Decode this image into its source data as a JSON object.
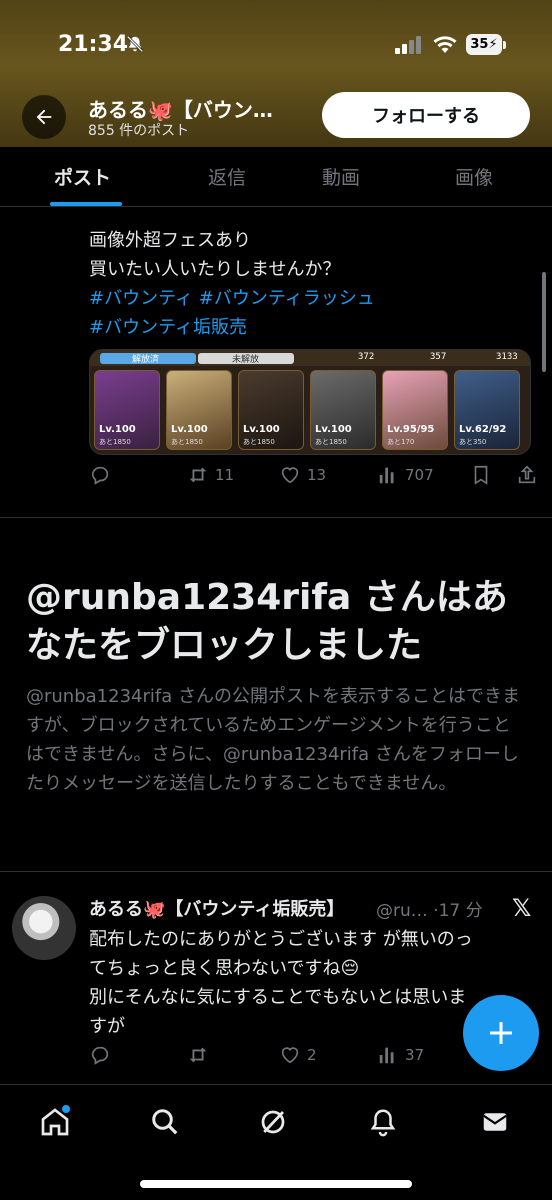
{
  "status_bar": {
    "time": "21:34",
    "battery": "35"
  },
  "header": {
    "name": "あるる🐙【バウン…",
    "post_count": "855 件のポスト",
    "follow_label": "フォローする"
  },
  "tabs": [
    {
      "label": "ポスト"
    },
    {
      "label": "返信"
    },
    {
      "label": "動画"
    },
    {
      "label": "画像"
    }
  ],
  "post1": {
    "line1": "画像外超フェスあり",
    "line2": "買いたい人いたりしませんか？",
    "hashtag1": "#バウンティ",
    "hashtag2": "#バウンティラッシュ",
    "hashtag3": "#バウンティ垢販売",
    "media": {
      "tab1": "解放済",
      "tab2": "未解放",
      "num1": "372",
      "num2": "357",
      "num3": "3133",
      "cards": [
        {
          "lv": "Lv.100",
          "sub": "あと1850"
        },
        {
          "lv": "Lv.100",
          "sub": "あと1850"
        },
        {
          "lv": "Lv.100",
          "sub": "あと1850"
        },
        {
          "lv": "Lv.100",
          "sub": "あと1850"
        },
        {
          "lv": "Lv.95/95",
          "sub": "あと170"
        },
        {
          "lv": "Lv.62/92",
          "sub": "あと350"
        }
      ]
    },
    "stats": {
      "retweets": "11",
      "likes": "13",
      "views": "707"
    }
  },
  "blocked": {
    "title": "@runba1234rifa さんはあなたをブロックしました",
    "body": "@runba1234rifa さんの公開ポストを表示することはできますが、ブロックされているためエンゲージメントを行うことはできません。さらに、@runba1234rifa さんをフォローしたりメッセージを送信したりすることもできません。"
  },
  "post2": {
    "name": "あるる🐙【バウンティ垢販売】",
    "handle_time": "@ru… ·17 分",
    "text_line1": "配布したのにありがとうございます が無いのっ",
    "text_line2": "てちょっと良く思わないですね😔",
    "text_line3": "別にそんなに気にすることでもないとは思いま",
    "text_line4": "すが",
    "stats": {
      "likes": "2",
      "views": "37"
    }
  },
  "colors": {
    "accent": "#1d9bf0",
    "background": "#000000",
    "muted": "#71767b"
  }
}
